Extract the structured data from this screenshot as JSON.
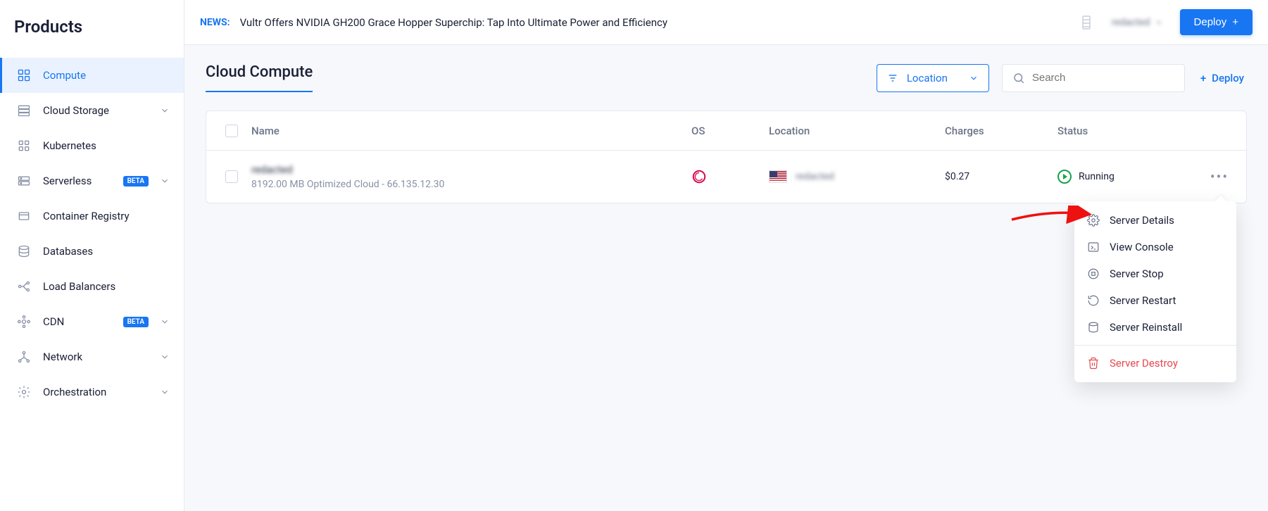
{
  "sidebar": {
    "title": "Products",
    "items": [
      {
        "label": "Compute",
        "icon": "compute-icon",
        "active": true
      },
      {
        "label": "Cloud Storage",
        "icon": "storage-icon",
        "expandable": true
      },
      {
        "label": "Kubernetes",
        "icon": "kubernetes-icon"
      },
      {
        "label": "Serverless",
        "icon": "serverless-icon",
        "badge": "BETA",
        "expandable": true
      },
      {
        "label": "Container Registry",
        "icon": "registry-icon"
      },
      {
        "label": "Databases",
        "icon": "databases-icon"
      },
      {
        "label": "Load Balancers",
        "icon": "loadbalancers-icon"
      },
      {
        "label": "CDN",
        "icon": "cdn-icon",
        "badge": "BETA",
        "expandable": true
      },
      {
        "label": "Network",
        "icon": "network-icon",
        "expandable": true
      },
      {
        "label": "Orchestration",
        "icon": "orchestration-icon",
        "expandable": true
      }
    ]
  },
  "topbar": {
    "news_label": "NEWS:",
    "news_text": "Vultr Offers NVIDIA GH200 Grace Hopper Superchip: Tap Into Ultimate Power and Efficiency",
    "user_name": "redacted",
    "deploy_label": "Deploy"
  },
  "page": {
    "title": "Cloud Compute",
    "filter_label": "Location",
    "search_placeholder": "Search",
    "deploy_link": "Deploy"
  },
  "table": {
    "headers": {
      "name": "Name",
      "os": "OS",
      "location": "Location",
      "charges": "Charges",
      "status": "Status"
    },
    "rows": [
      {
        "name": "redacted",
        "subtitle": "8192.00 MB Optimized Cloud - 66.135.12.30",
        "os": "debian",
        "location_flag": "us",
        "location_text": "redacted",
        "charges": "$0.27",
        "status": "Running"
      }
    ]
  },
  "context_menu": {
    "items": [
      {
        "label": "Server Details",
        "icon": "gear-icon"
      },
      {
        "label": "View Console",
        "icon": "console-icon"
      },
      {
        "label": "Server Stop",
        "icon": "stop-icon"
      },
      {
        "label": "Server Restart",
        "icon": "restart-icon"
      },
      {
        "label": "Server Reinstall",
        "icon": "reinstall-icon"
      },
      {
        "label": "Server Destroy",
        "icon": "trash-icon",
        "danger": true,
        "separated": true
      }
    ]
  }
}
